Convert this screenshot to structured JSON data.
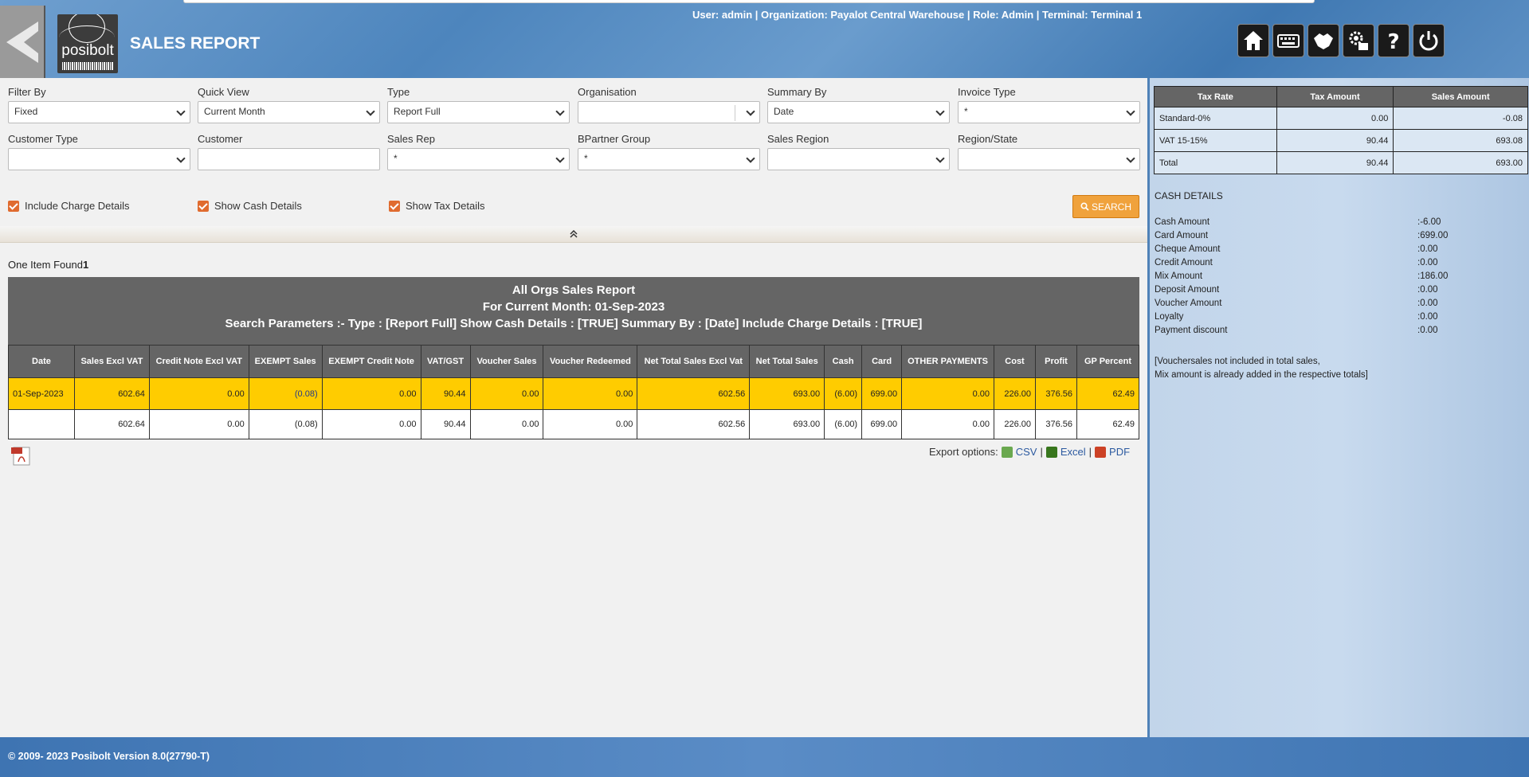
{
  "header": {
    "title": "SALES REPORT",
    "logo_text": "posibolt",
    "user_info": "User: admin | Organization: Payalot Central Warehouse | Role: Admin | Terminal: Terminal 1"
  },
  "toolbar": {
    "icons": [
      "home-icon",
      "keyboard-icon",
      "handshake-icon",
      "settings-icon",
      "help-icon",
      "power-icon"
    ]
  },
  "filters": {
    "filter_by": {
      "label": "Filter By",
      "value": "Fixed"
    },
    "quick_view": {
      "label": "Quick View",
      "value": "Current Month"
    },
    "type": {
      "label": "Type",
      "value": "Report Full"
    },
    "organisation": {
      "label": "Organisation",
      "value": ""
    },
    "summary_by": {
      "label": "Summary By",
      "value": "Date"
    },
    "invoice_type": {
      "label": "Invoice Type",
      "value": "*"
    },
    "customer_type": {
      "label": "Customer Type",
      "value": ""
    },
    "customer": {
      "label": "Customer",
      "value": ""
    },
    "sales_rep": {
      "label": "Sales Rep",
      "value": "*"
    },
    "bpartner_group": {
      "label": "BPartner Group",
      "value": "*"
    },
    "sales_region": {
      "label": "Sales Region",
      "value": ""
    },
    "region_state": {
      "label": "Region/State",
      "value": ""
    }
  },
  "checkboxes": {
    "charge": "Include Charge Details",
    "cash": "Show Cash Details",
    "tax": "Show Tax Details"
  },
  "search_label": "SEARCH",
  "found": {
    "text": "One Item Found",
    "count": "1"
  },
  "report": {
    "title": "All Orgs Sales Report",
    "subtitle": "For Current Month: 01-Sep-2023",
    "params": "Search Parameters :- Type : [Report Full] Show Cash Details : [TRUE] Summary By : [Date] Include Charge Details : [TRUE]",
    "columns": [
      "Date",
      "Sales Excl VAT",
      "Credit Note Excl VAT",
      "EXEMPT Sales",
      "EXEMPT Credit Note",
      "VAT/GST",
      "Voucher Sales",
      "Voucher Redeemed",
      "Net Total Sales Excl Vat",
      "Net Total Sales",
      "Cash",
      "Card",
      "OTHER PAYMENTS",
      "Cost",
      "Profit",
      "GP Percent"
    ],
    "rows": [
      [
        "01-Sep-2023",
        "602.64",
        "0.00",
        "(0.08)",
        "0.00",
        "90.44",
        "0.00",
        "0.00",
        "602.56",
        "693.00",
        "(6.00)",
        "699.00",
        "0.00",
        "226.00",
        "376.56",
        "62.49"
      ]
    ],
    "totals": [
      "",
      "602.64",
      "0.00",
      "(0.08)",
      "0.00",
      "90.44",
      "0.00",
      "0.00",
      "602.56",
      "693.00",
      "(6.00)",
      "699.00",
      "0.00",
      "226.00",
      "376.56",
      "62.49"
    ]
  },
  "export": {
    "label": "Export options:",
    "csv": "CSV",
    "excel": "Excel",
    "pdf": "PDF"
  },
  "tax_table": {
    "columns": [
      "Tax Rate",
      "Tax Amount",
      "Sales Amount"
    ],
    "rows": [
      [
        "Standard-0%",
        "0.00",
        "-0.08"
      ],
      [
        "VAT 15-15%",
        "90.44",
        "693.08"
      ],
      [
        "Total",
        "90.44",
        "693.00"
      ]
    ]
  },
  "cash_details": {
    "title": "CASH DETAILS",
    "items": [
      {
        "label": "Cash Amount",
        "value": ":-6.00"
      },
      {
        "label": "Card Amount",
        "value": ":699.00"
      },
      {
        "label": "Cheque Amount",
        "value": ":0.00"
      },
      {
        "label": "Credit Amount",
        "value": ":0.00"
      },
      {
        "label": "Mix Amount",
        "value": ":186.00"
      },
      {
        "label": "Deposit Amount",
        "value": ":0.00"
      },
      {
        "label": "Voucher Amount",
        "value": ":0.00"
      },
      {
        "label": "Loyalty",
        "value": ":0.00"
      },
      {
        "label": "Payment discount",
        "value": ":0.00"
      }
    ],
    "note_line1": "[Vouchersales not included in total sales,",
    "note_line2": "Mix amount is already added in the respective totals]"
  },
  "footer": "© 2009- 2023 Posibolt Version  8.0(27790-T)"
}
